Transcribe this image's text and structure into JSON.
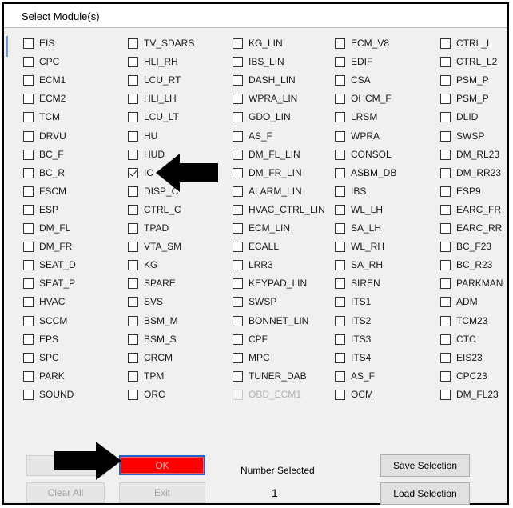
{
  "window": {
    "title": "Select Module(s)"
  },
  "modules": [
    [
      {
        "label": "EIS",
        "checked": false
      },
      {
        "label": "CPC",
        "checked": false
      },
      {
        "label": "ECM1",
        "checked": false
      },
      {
        "label": "ECM2",
        "checked": false
      },
      {
        "label": "TCM",
        "checked": false
      },
      {
        "label": "DRVU",
        "checked": false
      },
      {
        "label": "BC_F",
        "checked": false
      },
      {
        "label": "BC_R",
        "checked": false
      },
      {
        "label": "FSCM",
        "checked": false
      },
      {
        "label": "ESP",
        "checked": false
      },
      {
        "label": "DM_FL",
        "checked": false
      },
      {
        "label": "DM_FR",
        "checked": false
      },
      {
        "label": "SEAT_D",
        "checked": false
      },
      {
        "label": "SEAT_P",
        "checked": false
      },
      {
        "label": "HVAC",
        "checked": false
      },
      {
        "label": "SCCM",
        "checked": false
      },
      {
        "label": "EPS",
        "checked": false
      },
      {
        "label": "SPC",
        "checked": false
      },
      {
        "label": "PARK",
        "checked": false
      },
      {
        "label": "SOUND",
        "checked": false
      }
    ],
    [
      {
        "label": "TV_SDARS",
        "checked": false
      },
      {
        "label": "HLI_RH",
        "checked": false
      },
      {
        "label": "LCU_RT",
        "checked": false
      },
      {
        "label": "HLI_LH",
        "checked": false
      },
      {
        "label": "LCU_LT",
        "checked": false
      },
      {
        "label": "HU",
        "checked": false
      },
      {
        "label": "HUD",
        "checked": false
      },
      {
        "label": "IC",
        "checked": true
      },
      {
        "label": "DISP_C",
        "checked": false
      },
      {
        "label": "CTRL_C",
        "checked": false
      },
      {
        "label": "TPAD",
        "checked": false
      },
      {
        "label": "VTA_SM",
        "checked": false
      },
      {
        "label": "KG",
        "checked": false
      },
      {
        "label": "SPARE",
        "checked": false
      },
      {
        "label": "SVS",
        "checked": false
      },
      {
        "label": "BSM_M",
        "checked": false
      },
      {
        "label": "BSM_S",
        "checked": false
      },
      {
        "label": "CRCM",
        "checked": false
      },
      {
        "label": "TPM",
        "checked": false
      },
      {
        "label": "ORC",
        "checked": false
      }
    ],
    [
      {
        "label": "KG_LIN",
        "checked": false
      },
      {
        "label": "IBS_LIN",
        "checked": false
      },
      {
        "label": "DASH_LIN",
        "checked": false
      },
      {
        "label": "WPRA_LIN",
        "checked": false
      },
      {
        "label": "GDO_LIN",
        "checked": false
      },
      {
        "label": "AS_F",
        "checked": false
      },
      {
        "label": "DM_FL_LIN",
        "checked": false
      },
      {
        "label": "DM_FR_LIN",
        "checked": false
      },
      {
        "label": "ALARM_LIN",
        "checked": false
      },
      {
        "label": "HVAC_CTRL_LIN",
        "checked": false
      },
      {
        "label": "ECM_LIN",
        "checked": false
      },
      {
        "label": "ECALL",
        "checked": false
      },
      {
        "label": "LRR3",
        "checked": false
      },
      {
        "label": "KEYPAD_LIN",
        "checked": false
      },
      {
        "label": "SWSP",
        "checked": false
      },
      {
        "label": "BONNET_LIN",
        "checked": false
      },
      {
        "label": "CPF",
        "checked": false
      },
      {
        "label": "MPC",
        "checked": false
      },
      {
        "label": "TUNER_DAB",
        "checked": false
      },
      {
        "label": "OBD_ECM1",
        "checked": false,
        "disabled": true
      }
    ],
    [
      {
        "label": "ECM_V8",
        "checked": false
      },
      {
        "label": "EDIF",
        "checked": false
      },
      {
        "label": "CSA",
        "checked": false
      },
      {
        "label": "OHCM_F",
        "checked": false
      },
      {
        "label": "LRSM",
        "checked": false
      },
      {
        "label": "WPRA",
        "checked": false
      },
      {
        "label": "CONSOL",
        "checked": false
      },
      {
        "label": "ASBM_DB",
        "checked": false
      },
      {
        "label": "IBS",
        "checked": false
      },
      {
        "label": "WL_LH",
        "checked": false
      },
      {
        "label": "SA_LH",
        "checked": false
      },
      {
        "label": "WL_RH",
        "checked": false
      },
      {
        "label": "SA_RH",
        "checked": false
      },
      {
        "label": "SIREN",
        "checked": false
      },
      {
        "label": "ITS1",
        "checked": false
      },
      {
        "label": "ITS2",
        "checked": false
      },
      {
        "label": "ITS3",
        "checked": false
      },
      {
        "label": "ITS4",
        "checked": false
      },
      {
        "label": "AS_F",
        "checked": false
      },
      {
        "label": "OCM",
        "checked": false
      }
    ],
    [
      {
        "label": "CTRL_L",
        "checked": false
      },
      {
        "label": "CTRL_L2",
        "checked": false
      },
      {
        "label": "PSM_P",
        "checked": false
      },
      {
        "label": "PSM_P",
        "checked": false
      },
      {
        "label": "DLID",
        "checked": false
      },
      {
        "label": "SWSP",
        "checked": false
      },
      {
        "label": "DM_RL23",
        "checked": false
      },
      {
        "label": "DM_RR23",
        "checked": false
      },
      {
        "label": "ESP9",
        "checked": false
      },
      {
        "label": "EARC_FR",
        "checked": false
      },
      {
        "label": "EARC_RR",
        "checked": false
      },
      {
        "label": "BC_F23",
        "checked": false
      },
      {
        "label": "BC_R23",
        "checked": false
      },
      {
        "label": "PARKMAN",
        "checked": false
      },
      {
        "label": "ADM",
        "checked": false
      },
      {
        "label": "TCM23",
        "checked": false
      },
      {
        "label": "CTC",
        "checked": false
      },
      {
        "label": "EIS23",
        "checked": false
      },
      {
        "label": "CPC23",
        "checked": false
      },
      {
        "label": "DM_FL23",
        "checked": false
      }
    ]
  ],
  "buttons": {
    "select_all": "Se",
    "ok": "OK",
    "clear_all": "Clear All",
    "exit": "Exit",
    "save_selection": "Save Selection",
    "load_selection": "Load Selection"
  },
  "status": {
    "number_selected_label": "Number Selected",
    "number_selected_value": "1"
  },
  "colors": {
    "ok_fill": "#ff0000",
    "ok_border": "#1e64c8",
    "arrow": "#000000"
  }
}
